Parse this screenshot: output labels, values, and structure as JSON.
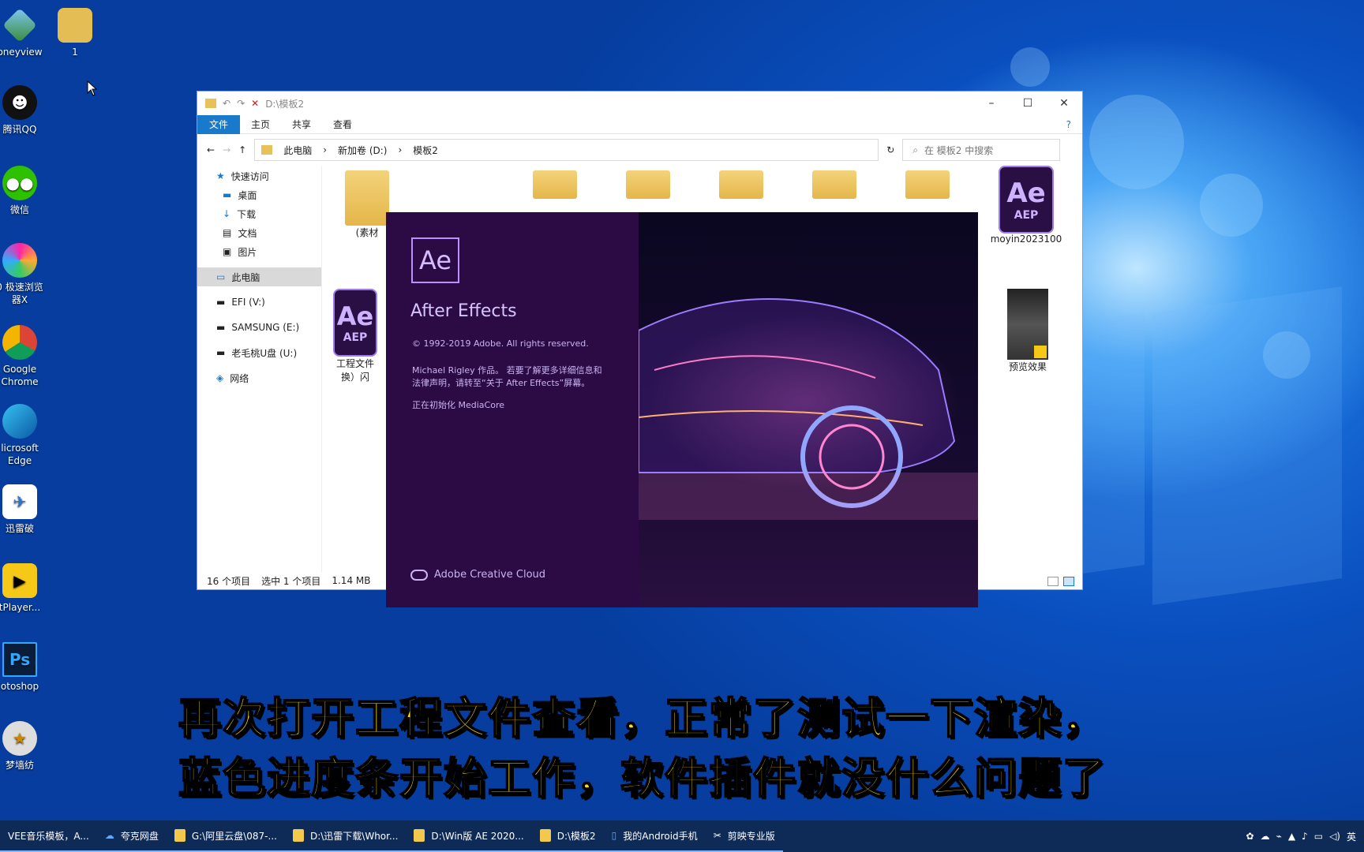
{
  "desktop": {
    "icons": [
      {
        "label": "oneyview"
      },
      {
        "label": "1"
      },
      {
        "label": "腾讯QQ"
      },
      {
        "label": "微信"
      },
      {
        "label": "0 极速浏览器X"
      },
      {
        "label": "Google Chrome"
      },
      {
        "label": "licrosoft Edge"
      },
      {
        "label": "迅雷破"
      },
      {
        "label": "tPlayer..."
      },
      {
        "label": "otoshop"
      },
      {
        "label": "梦墙纺"
      }
    ]
  },
  "explorer": {
    "title": "D:\\模板2",
    "ribbon_tabs": [
      "文件",
      "主页",
      "共享",
      "查看"
    ],
    "breadcrumb": [
      "此电脑",
      "新加卷 (D:)",
      "模板2"
    ],
    "search_placeholder": "在 模板2 中搜索",
    "nav_items": [
      {
        "label": "快速访问"
      },
      {
        "label": "桌面"
      },
      {
        "label": "下载"
      },
      {
        "label": "文档"
      },
      {
        "label": "图片"
      },
      {
        "label": "此电脑"
      },
      {
        "label": "EFI (V:)"
      },
      {
        "label": "SAMSUNG (E:)"
      },
      {
        "label": "老毛桃U盘 (U:)"
      },
      {
        "label": "网络"
      }
    ],
    "files": {
      "folder_label": "(素材",
      "aep_badge": "AEP",
      "aep_icon_text": "Ae",
      "aep_label": "moyin2023100",
      "project_label_1": "工程文件",
      "project_label_2": "换）闪",
      "preview_label": "预览效果"
    },
    "status": {
      "count": "16 个项目",
      "selected": "选中 1 个项目",
      "size": "1.14 MB"
    }
  },
  "splash": {
    "logo_text": "Ae",
    "app_name": "After Effects",
    "copyright": "© 1992-2019 Adobe. All rights reserved.",
    "credit_line1": "Michael Rigley 作品。 若要了解更多详细信息和",
    "credit_line2": "法律声明，请转至“关于 After Effects”屏幕。",
    "init_status": "正在初始化 MediaCore",
    "brand": "Adobe Creative Cloud"
  },
  "subtitle": {
    "line1": "再次打开工程文件查看，正常了测试一下渲染，",
    "line2": "蓝色进度条开始工作，软件插件就没什么问题了"
  },
  "taskbar": {
    "items": [
      {
        "label": "VEE音乐模板，A..."
      },
      {
        "label": "夸克网盘"
      },
      {
        "label": "G:\\阿里云盘\\087-..."
      },
      {
        "label": "D:\\迅雷下载\\Whor..."
      },
      {
        "label": "D:\\Win版 AE 2020..."
      },
      {
        "label": "D:\\模板2"
      },
      {
        "label": "我的Android手机"
      },
      {
        "label": "剪映专业版"
      }
    ],
    "ime": "英"
  },
  "colors": {
    "ribbon_file": "#1979ca",
    "splash_bg": "#2c0b45",
    "subtitle": "#ffe100",
    "taskbar": "#0e2a57"
  }
}
